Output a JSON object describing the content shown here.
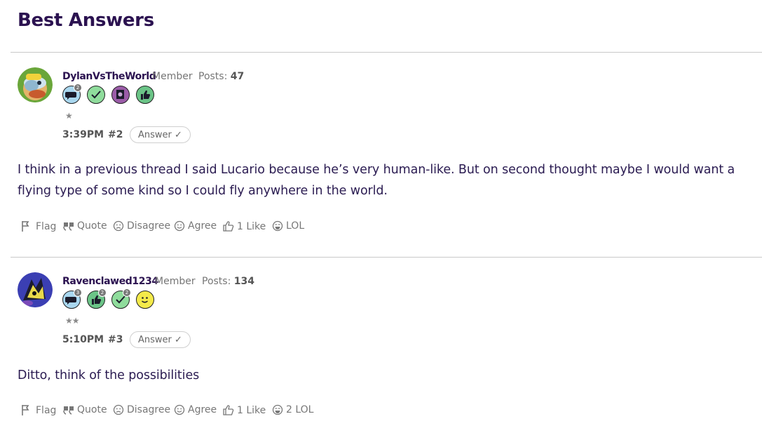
{
  "page": {
    "title": "Best Answers"
  },
  "posts": [
    {
      "username": "DylanVsTheWorld",
      "role": "Member",
      "posts_label": "Posts:",
      "posts_count": "47",
      "badges": [
        {
          "icon": "comment-badge-icon",
          "count": "2",
          "color": "#a9d7ef"
        },
        {
          "icon": "check-badge-icon",
          "count": "",
          "color": "#8fdc9c"
        },
        {
          "icon": "photo-badge-icon",
          "count": "",
          "color": "#9b5ca8"
        },
        {
          "icon": "thumbs-up-badge-icon",
          "count": "",
          "color": "#6bc487"
        }
      ],
      "stars": "★",
      "time": "3:39PM",
      "number": "#2",
      "answer_label": "Answer ✓",
      "text": "I think in a previous thread I said Lucario because he’s very human-like. But on second thought maybe I would want a flying type of some kind so I could fly anywhere in the world.",
      "actions": {
        "flag": "Flag",
        "quote": "Quote",
        "disagree": "Disagree",
        "agree": "Agree",
        "like": "1 Like",
        "lol": "LOL"
      }
    },
    {
      "username": "Ravenclawed1234",
      "role": "Member",
      "posts_label": "Posts:",
      "posts_count": "134",
      "badges": [
        {
          "icon": "comment-badge-icon",
          "count": "3",
          "color": "#a9d7ef"
        },
        {
          "icon": "thumbs-up-badge-icon",
          "count": "2",
          "color": "#6bc487"
        },
        {
          "icon": "check-badge-icon",
          "count": "2",
          "color": "#8fdc9c"
        },
        {
          "icon": "smiley-badge-icon",
          "count": "",
          "color": "#f4ea4a"
        }
      ],
      "stars": "★★",
      "time": "5:10PM",
      "number": "#3",
      "answer_label": "Answer ✓",
      "text": "Ditto, think of the possibilities",
      "actions": {
        "flag": "Flag",
        "quote": "Quote",
        "disagree": "Disagree",
        "agree": "Agree",
        "like": "1 Like",
        "lol": "2 LOL"
      }
    }
  ]
}
